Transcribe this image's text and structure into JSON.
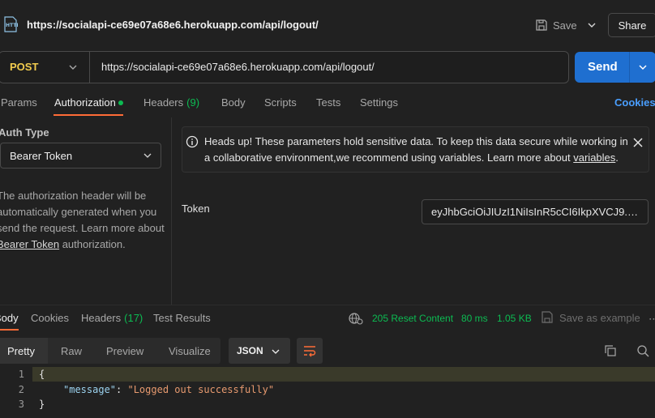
{
  "header": {
    "page_url": "https://socialapi-ce69e07a68e6.herokuapp.com/api/logout/",
    "save_label": "Save",
    "share_label": "Share",
    "icon": "http-icon"
  },
  "request": {
    "method": "POST",
    "url": "https://socialapi-ce69e07a68e6.herokuapp.com/api/logout/",
    "send_label": "Send"
  },
  "tabs": {
    "params": "Params",
    "authorization": "Authorization",
    "headers": "Headers",
    "headers_count": "(9)",
    "body": "Body",
    "scripts": "Scripts",
    "tests": "Tests",
    "settings": "Settings",
    "cookies": "Cookies"
  },
  "auth": {
    "type_label": "Auth Type",
    "selected_type": "Bearer Token",
    "desc_pre": "The authorization header will be automatically generated when you send the request. Learn more about ",
    "desc_link": "Bearer Token",
    "desc_post": " authorization.",
    "banner_pre": "Heads up! These parameters hold sensitive data. To keep this data secure while working in a collaborative environment,we recommend using variables. Learn more about ",
    "banner_link": "variables",
    "banner_post": ".",
    "token_label": "Token",
    "token_value": "eyJhbGciOiJIUzI1NiIsInR5cCI6IkpXVCJ9.eyJ..."
  },
  "response": {
    "tabs": {
      "body": "Body",
      "cookies": "Cookies",
      "headers": "Headers",
      "headers_count": "(17)",
      "test_results": "Test Results"
    },
    "status": "205 Reset Content",
    "time": "80 ms",
    "size": "1.05 KB",
    "save_example": "Save as example",
    "format_tabs": {
      "pretty": "Pretty",
      "raw": "Raw",
      "preview": "Preview",
      "visualize": "Visualize"
    },
    "format": "JSON",
    "code": {
      "line_numbers": [
        "1",
        "2",
        "3"
      ],
      "open_brace": "{",
      "key": "\"message\"",
      "colon": ": ",
      "value": "\"Logged out successfully\"",
      "close_brace": "}"
    }
  },
  "colors": {
    "accent": "#ff6c37",
    "send": "#1f6fd0",
    "success": "#0cbb52",
    "method": "#f2cc4e",
    "link": "#4a9fff"
  }
}
